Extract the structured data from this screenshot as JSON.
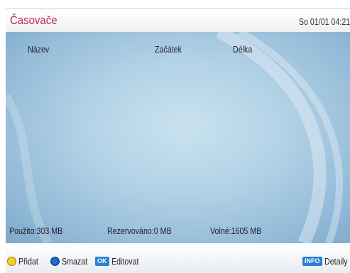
{
  "header": {
    "title": "Časovače",
    "datetime": "So 01/01 04:21"
  },
  "table": {
    "columns": [
      "Název",
      "Začátek",
      "Délka"
    ],
    "rows": []
  },
  "storage": {
    "used": "Použito:303 MB",
    "reserved": "Rezervováno:0 MB",
    "free": "Volné:1605 MB"
  },
  "footer": {
    "add_label": "Přidat",
    "add_color": "#f3d21c",
    "delete_label": "Smazat",
    "delete_color": "#1e6fd0",
    "edit_key": "OK",
    "edit_label": "Editovat",
    "info_key": "INFO",
    "details_label": "Detaily"
  }
}
